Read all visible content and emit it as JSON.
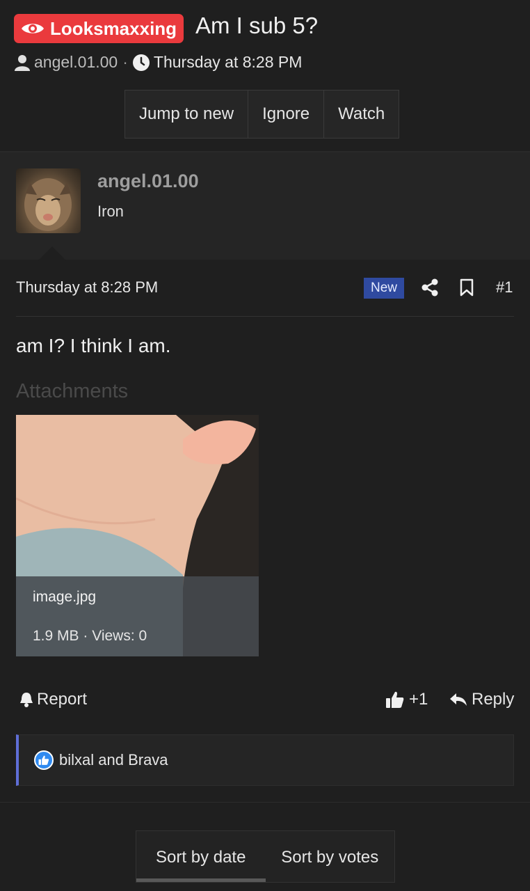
{
  "thread": {
    "prefix": "Looksmaxxing",
    "title": "Am I sub 5?",
    "author": "angel.01.00",
    "separator": "·",
    "date": "Thursday at 8:28 PM"
  },
  "thread_actions": {
    "jump_to_new": "Jump to new",
    "ignore": "Ignore",
    "watch": "Watch"
  },
  "post": {
    "username": "angel.01.00",
    "user_title": "Iron",
    "date": "Thursday at 8:28 PM",
    "new_badge": "New",
    "post_number": "#1",
    "body": "am I? I think I am.",
    "attachments_heading": "Attachments",
    "attachment": {
      "filename": "image.jpg",
      "meta": "1.9 MB · Views: 0"
    },
    "report_label": "Report",
    "like_label": "+1",
    "reply_label": "Reply",
    "reactions_text": "bilxal and Brava"
  },
  "sort": {
    "by_date": "Sort by date",
    "by_votes": "Sort by votes",
    "active": "by_date"
  },
  "colors": {
    "prefix_bg": "#ea3a3d",
    "new_badge_bg": "#2f4aa0",
    "reaction_accent": "#5f6ed6",
    "like_icon": "#2f8af0"
  },
  "icons": [
    "eye-icon",
    "user-icon",
    "clock-icon",
    "share-icon",
    "bookmark-icon",
    "bell-icon",
    "thumbs-up-icon",
    "reply-icon"
  ]
}
